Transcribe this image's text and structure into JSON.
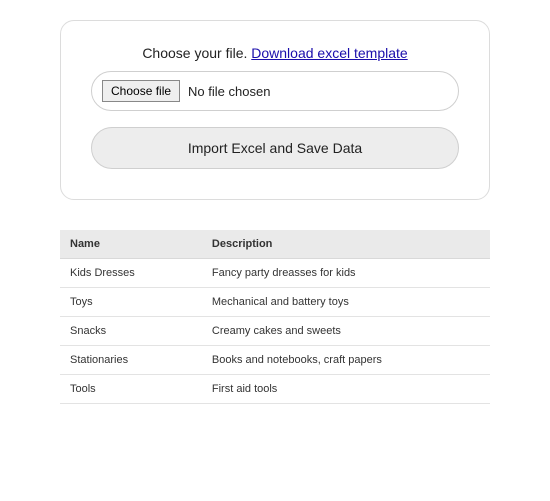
{
  "upload": {
    "prompt": "Choose your file. ",
    "template_link": "Download excel template",
    "choose_btn": "Choose file",
    "no_file": "No file chosen",
    "import_btn": "Import Excel and Save Data"
  },
  "table": {
    "headers": {
      "name": "Name",
      "description": "Description"
    },
    "rows": [
      {
        "name": "Kids Dresses",
        "description": "Fancy party dreasses for kids"
      },
      {
        "name": "Toys",
        "description": "Mechanical and battery toys"
      },
      {
        "name": "Snacks",
        "description": "Creamy cakes and sweets"
      },
      {
        "name": "Stationaries",
        "description": "Books and notebooks, craft papers"
      },
      {
        "name": "Tools",
        "description": "First aid tools"
      }
    ]
  }
}
